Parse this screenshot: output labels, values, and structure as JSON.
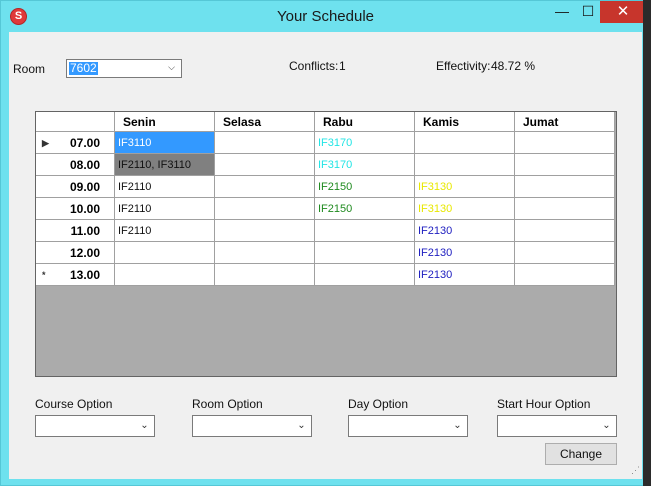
{
  "window": {
    "title": "Your Schedule",
    "app_icon_letter": "S",
    "min_glyph": "—",
    "max_glyph": "☐",
    "close_glyph": "✕"
  },
  "room": {
    "label": "Room",
    "value": "7602"
  },
  "conflicts": {
    "label": "Conflicts:",
    "value": "1"
  },
  "effectivity": {
    "label": "Effectivity:",
    "value": "48.72 %"
  },
  "grid": {
    "columns": [
      "",
      "Senin",
      "Selasa",
      "Rabu",
      "Kamis",
      "Jumat"
    ],
    "rows": [
      {
        "time": "07.00",
        "marker": "▶",
        "cells": [
          "IF3110",
          "",
          "IF3170",
          "",
          ""
        ]
      },
      {
        "time": "08.00",
        "marker": "",
        "cells": [
          "IF2110, IF3110",
          "",
          "IF3170",
          "",
          ""
        ]
      },
      {
        "time": "09.00",
        "marker": "",
        "cells": [
          "IF2110",
          "",
          "IF2150",
          "IF3130",
          ""
        ]
      },
      {
        "time": "10.00",
        "marker": "",
        "cells": [
          "IF2110",
          "",
          "IF2150",
          "IF3130",
          ""
        ]
      },
      {
        "time": "11.00",
        "marker": "",
        "cells": [
          "IF2110",
          "",
          "",
          "IF2130",
          ""
        ]
      },
      {
        "time": "12.00",
        "marker": "",
        "cells": [
          "",
          "",
          "",
          "IF2130",
          ""
        ]
      },
      {
        "time": "13.00",
        "marker": "*",
        "cells": [
          "",
          "",
          "",
          "IF2130",
          ""
        ]
      }
    ],
    "colors": {
      "selected_bg": "#3399ff",
      "conflict_bg": "#808080",
      "IF3170": "#22e5e5",
      "IF2150": "#1f8a1f",
      "IF3130": "#e8e800",
      "IF2130": "#2020c0",
      "default": "#111111"
    }
  },
  "options": {
    "course": {
      "label": "Course Option",
      "value": ""
    },
    "room": {
      "label": "Room Option",
      "value": ""
    },
    "day": {
      "label": "Day Option",
      "value": ""
    },
    "start_hour": {
      "label": "Start Hour Option",
      "value": ""
    }
  },
  "change_button": {
    "label": "Change"
  },
  "dropdown_glyph": "⌄"
}
